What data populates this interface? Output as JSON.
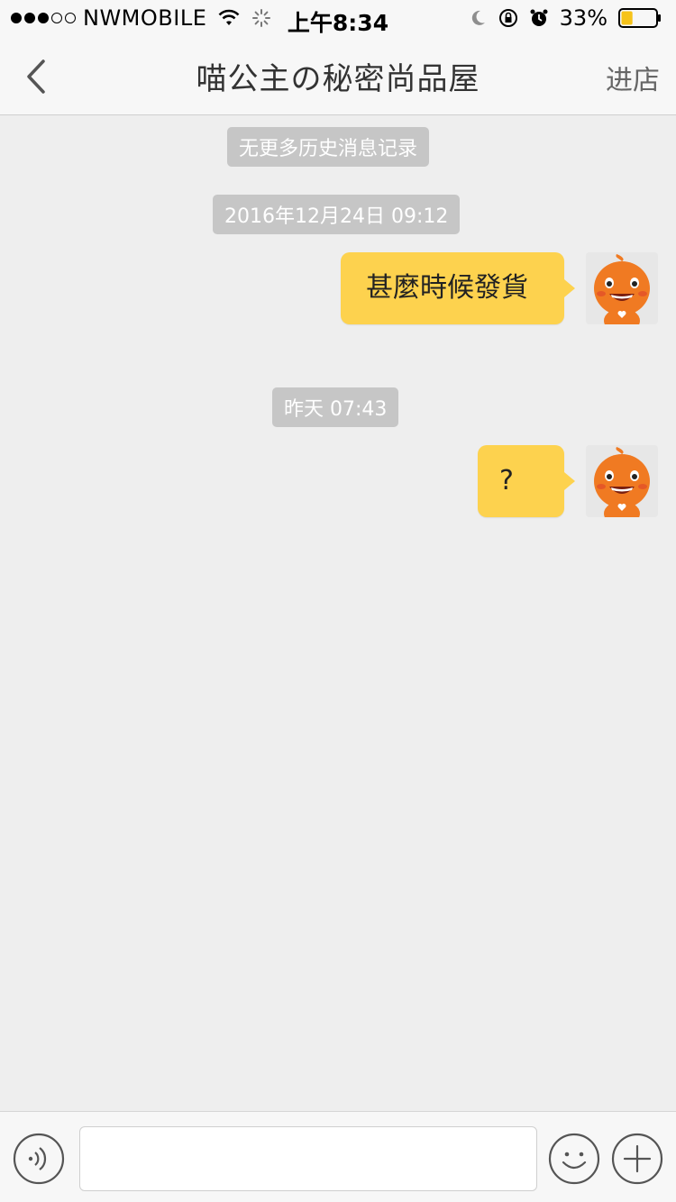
{
  "status_bar": {
    "signal_dots": [
      true,
      true,
      true,
      false,
      false
    ],
    "carrier": "NWMOBILE",
    "time": "上午8:34",
    "battery_pct": "33%",
    "battery_level": 0.33,
    "battery_color": "#f6c31a"
  },
  "nav": {
    "title": "喵公主の秘密尚品屋",
    "action_label": "进店"
  },
  "chat": {
    "history_notice": "无更多历史消息记录",
    "messages": [
      {
        "timestamp": "2016年12月24日 09:12",
        "text": "甚麼時候發貨",
        "sender": "me"
      },
      {
        "timestamp": "昨天 07:43",
        "text": "?",
        "sender": "me"
      }
    ]
  },
  "input_bar": {
    "value": "",
    "placeholder": ""
  },
  "colors": {
    "bubble": "#fdd24e",
    "background": "#eeeeee",
    "pill": "#c6c6c6",
    "avatar_orange": "#f07a22"
  },
  "icons": {
    "back": "chevron-left-icon",
    "voice": "voice-icon",
    "emoji": "smiley-icon",
    "plus": "plus-icon",
    "avatar": "orange-mascot-avatar"
  }
}
